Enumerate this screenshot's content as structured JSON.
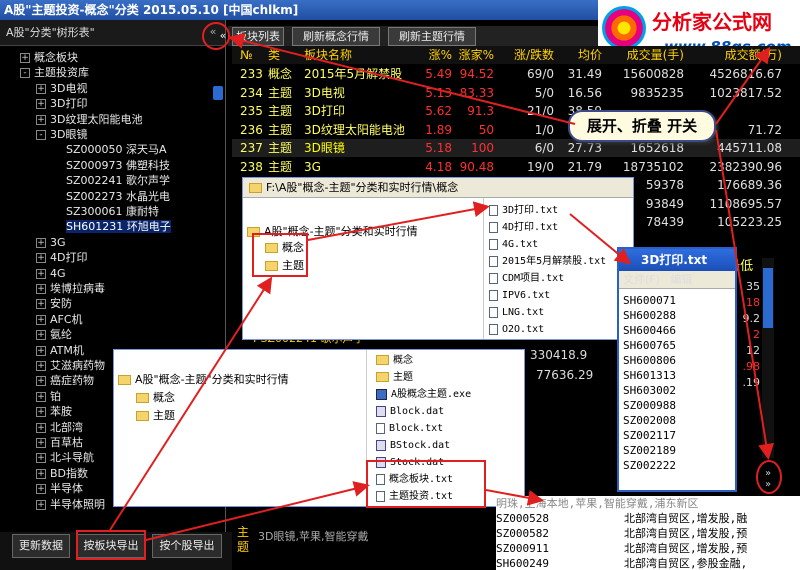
{
  "window": {
    "title": "A股\"主题投资-概念\"分类 2015.05.10 [中国chlkm]"
  },
  "logo": {
    "line1": "分析家公式网",
    "line2": "www.88gs.com"
  },
  "tree": {
    "header": "A股\"分类\"树形表\"",
    "collapse_glyph": "«",
    "items": [
      {
        "toggle": "+",
        "label": "概念板块"
      },
      {
        "toggle": "-",
        "label": "主题投资库"
      },
      {
        "toggle": "+",
        "label": "3D电视"
      },
      {
        "toggle": "+",
        "label": "3D打印"
      },
      {
        "toggle": "+",
        "label": "3D纹理太阳能电池"
      },
      {
        "toggle": "-",
        "label": "3D眼镜"
      },
      {
        "toggle": "",
        "label": "SZ000050 深天马A"
      },
      {
        "toggle": "",
        "label": "SZ000973 佛塑科技"
      },
      {
        "toggle": "",
        "label": "SZ002241 歌尔声学"
      },
      {
        "toggle": "",
        "label": "SZ002273 水晶光电"
      },
      {
        "toggle": "",
        "label": "SZ300061 康耐特"
      },
      {
        "toggle": "",
        "label": "SH601231 环旭电子"
      },
      {
        "toggle": "+",
        "label": "3G"
      },
      {
        "toggle": "+",
        "label": "4D打印"
      },
      {
        "toggle": "+",
        "label": "4G"
      },
      {
        "toggle": "+",
        "label": "埃博拉病毒"
      },
      {
        "toggle": "+",
        "label": "安防"
      },
      {
        "toggle": "+",
        "label": "AFC机"
      },
      {
        "toggle": "+",
        "label": "氨纶"
      },
      {
        "toggle": "+",
        "label": "ATM机"
      },
      {
        "toggle": "+",
        "label": "艾滋病药物"
      },
      {
        "toggle": "+",
        "label": "癌症药物"
      },
      {
        "toggle": "+",
        "label": "铂"
      },
      {
        "toggle": "+",
        "label": "苯胺"
      },
      {
        "toggle": "+",
        "label": "北部湾"
      },
      {
        "toggle": "+",
        "label": "百草枯"
      },
      {
        "toggle": "+",
        "label": "北斗导航"
      },
      {
        "toggle": "+",
        "label": "BD指数"
      },
      {
        "toggle": "+",
        "label": "半导体"
      },
      {
        "toggle": "+",
        "label": "半导体照明"
      }
    ]
  },
  "buttons": {
    "refresh": "更新数据",
    "export_by_block": "按板块导出",
    "export_by_stock": "按个股导出"
  },
  "toolbar": {
    "collapse": "«",
    "block_list": "板块列表",
    "refresh_concept": "刷新概念行情",
    "refresh_theme": "刷新主题行情"
  },
  "grid": {
    "headers": [
      "№",
      "类",
      "板块名称",
      "涨%",
      "涨家%",
      "涨/跌数",
      "均价",
      "成交量(手)",
      "成交额(万)"
    ],
    "rows": [
      {
        "no": "233",
        "type": "概念",
        "name": "2015年5月解禁股",
        "chg": "5.49",
        "up": "94.52",
        "ud": "69/0",
        "avg": "31.49",
        "vol": "15600828",
        "amt": "4526816.67"
      },
      {
        "no": "234",
        "type": "主题",
        "name": "3D电视",
        "chg": "5.13",
        "up": "83.33",
        "ud": "5/0",
        "avg": "16.56",
        "vol": "9835235",
        "amt": "1023817.52"
      },
      {
        "no": "235",
        "type": "主题",
        "name": "3D打印",
        "chg": "5.62",
        "up": "91.3",
        "ud": "21/0",
        "avg": "38.59",
        "vol": "",
        "amt": ""
      },
      {
        "no": "236",
        "type": "主题",
        "name": "3D纹理太阳能电池",
        "chg": "1.89",
        "up": "50",
        "ud": "1/0",
        "avg": "",
        "vol": "",
        "amt": "71.72"
      },
      {
        "no": "237",
        "type": "主题",
        "name": "3D眼镜",
        "chg": "5.18",
        "up": "100",
        "ud": "6/0",
        "avg": "27.73",
        "vol": "1652618",
        "amt": "445711.08"
      },
      {
        "no": "238",
        "type": "主题",
        "name": "3G",
        "chg": "4.18",
        "up": "90.48",
        "ud": "19/0",
        "avg": "21.79",
        "vol": "18735102",
        "amt": "2382390.96"
      }
    ],
    "partial_rows": [
      {
        "vol": "59378",
        "amt": "176689.36"
      },
      {
        "vol": "93849",
        "amt": "1108695.57"
      },
      {
        "vol": "78439",
        "amt": "105223.25"
      }
    ]
  },
  "right_panel": {
    "col_hint": "高 最低",
    "row_hint": "4  SZ002241  歌尔声学",
    "vals": [
      "330418.9",
      "77636.29"
    ],
    "side_vals": [
      "35",
      ".18",
      "9.2",
      "2",
      "12",
      ".98",
      ".19"
    ]
  },
  "detail": {
    "label": "主题",
    "text": "3D眼镜,苹果,智能穿戴"
  },
  "explorer1": {
    "address": "F:\\A股\"概念-主题\"分类和实时行情\\概念",
    "root": "A股\"概念-主题\"分类和实时行情",
    "children": [
      "概念",
      "主题"
    ],
    "files": [
      "3D打印.txt",
      "4D打印.txt",
      "4G.txt",
      "2015年5月解禁股.txt",
      "CDM项目.txt",
      "IPV6.txt",
      "LNG.txt",
      "O2O.txt"
    ]
  },
  "explorer2": {
    "root": "A股\"概念-主题\"分类和实时行情",
    "children": [
      "概念",
      "主题"
    ],
    "files": [
      "概念",
      "主题",
      "A股概念主题.exe",
      "Block.dat",
      "Block.txt",
      "BStock.dat",
      "Stock.dat",
      "概念板块.txt",
      "主题投资.txt"
    ]
  },
  "notepad": {
    "title": "3D打印.txt",
    "menu_file": "文件(F)",
    "menu_edit": "编辑",
    "lines": [
      "SH600071",
      "SH600288",
      "SH600466",
      "SH600765",
      "SH600806",
      "SH601313",
      "SH603002",
      "SZ000988",
      "SZ002008",
      "SZ002117",
      "SZ002189",
      "SZ002222"
    ]
  },
  "bottom_text": {
    "header": "明珠,上海本地,苹果,智能穿戴,浦东新区",
    "lines": [
      {
        "code": "SZ000528",
        "desc": "北部湾自贸区,增发股,融"
      },
      {
        "code": "SZ000582",
        "desc": "北部湾自贸区,增发股,预"
      },
      {
        "code": "SZ000911",
        "desc": "北部湾自贸区,增发股,预"
      },
      {
        "code": "SH600249",
        "desc": "北部湾自贸区,参股金融,"
      }
    ]
  },
  "callout": {
    "text": "展开、折叠 开关"
  },
  "colors": {
    "gain": "#ff3030",
    "highlight": "#ffff00",
    "type": "#ffff60"
  }
}
